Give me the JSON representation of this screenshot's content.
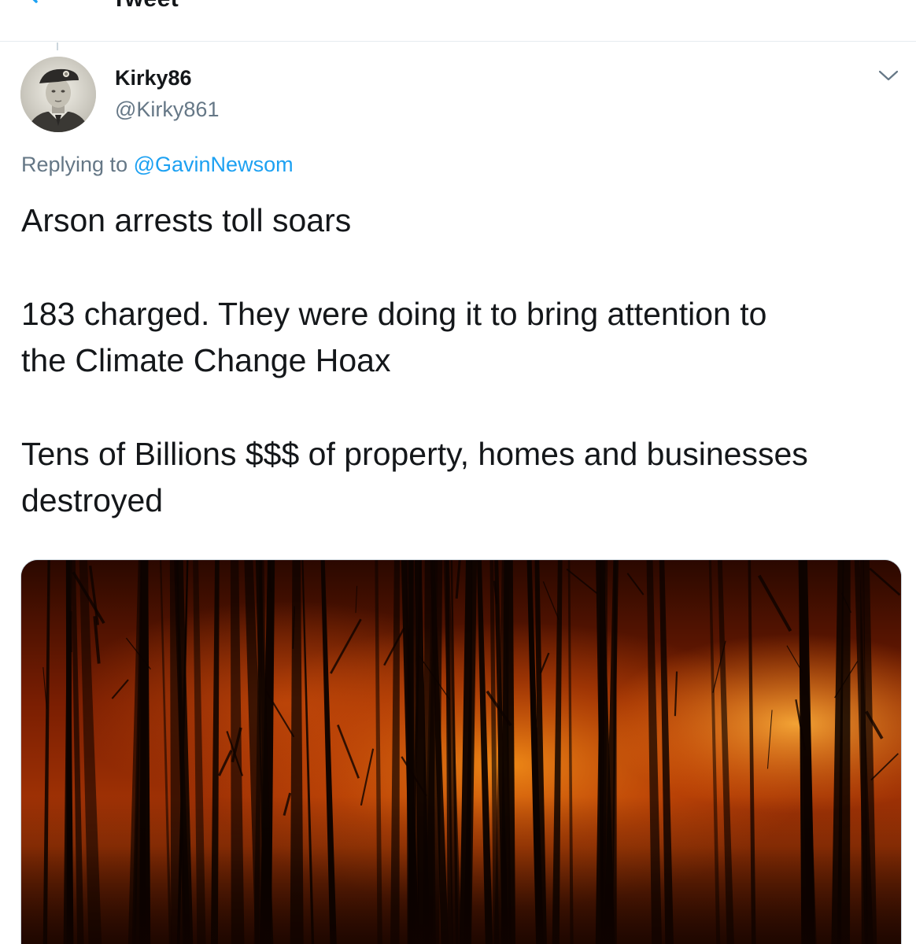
{
  "header": {
    "title": "Tweet"
  },
  "tweet": {
    "author": {
      "display_name": "Kirky86",
      "handle": "@Kirky861"
    },
    "replying_prefix": "Replying to",
    "replying_to": "@GavinNewsom",
    "text_lines": [
      "Arson arrests toll soars",
      "183 charged. They were doing it to bring attention to the Climate Change Hoax",
      "Tens of Billions $$$ of property, homes and businesses destroyed"
    ]
  },
  "colors": {
    "link": "#1da1f2",
    "secondary_text": "#657786",
    "primary_text": "#14171a"
  },
  "icons": [
    "back-arrow-icon",
    "chevron-down-icon"
  ]
}
